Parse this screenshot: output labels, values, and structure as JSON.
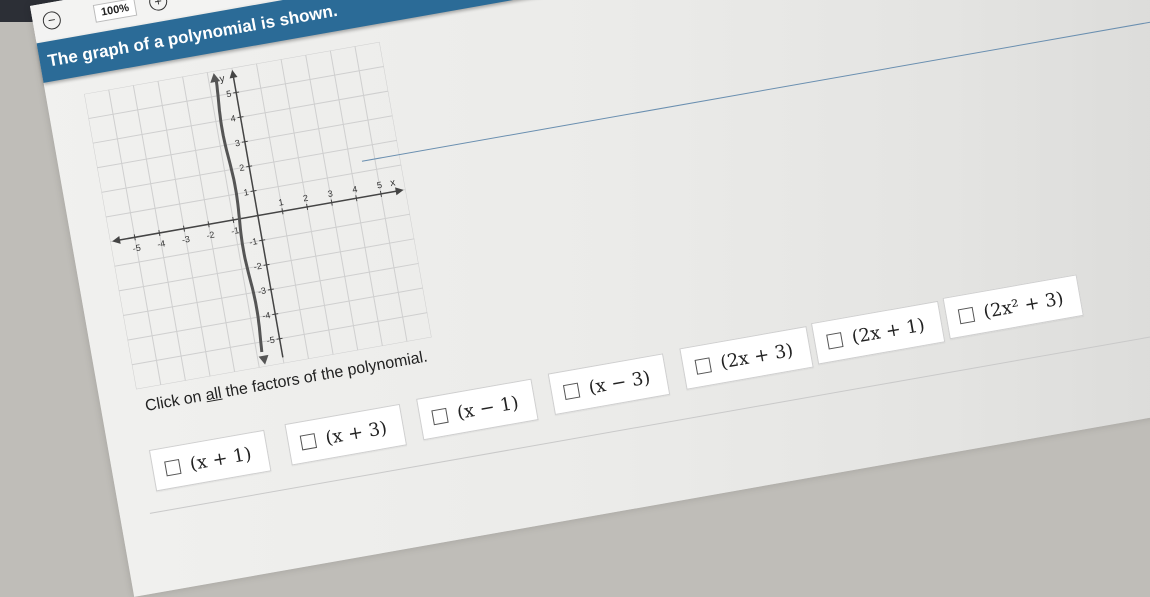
{
  "toolbar": {
    "zoom_out_icon": "minus-circle-icon",
    "zoom_in_icon": "plus-circle-icon",
    "zoom_level": "100%",
    "tools": [
      "pencil-icon",
      "eraser-icon"
    ]
  },
  "question": {
    "title": "The graph of a polynomial is shown.",
    "instruction_prefix": "Click on ",
    "instruction_emphasis": "all",
    "instruction_suffix": " the factors of the polynomial."
  },
  "graph": {
    "axis_x_label": "x",
    "axis_y_label": "y",
    "x_ticks": [
      "-5",
      "-4",
      "-3",
      "-2",
      "-1",
      "1",
      "2",
      "3",
      "4",
      "5"
    ],
    "y_ticks": [
      "5",
      "4",
      "3",
      "2",
      "1",
      "-1",
      "-2",
      "-3",
      "-4",
      "-5"
    ],
    "x_range": [
      -5,
      5
    ],
    "y_range": [
      -5,
      5
    ],
    "grid": true
  },
  "options": [
    {
      "label": "(x + 1)"
    },
    {
      "label": "(x + 3)"
    },
    {
      "label": "(x − 1)"
    },
    {
      "label": "(x − 3)"
    },
    {
      "label": "(2x + 3)"
    },
    {
      "label": "(2x + 1)"
    },
    {
      "label": "(2x² + 3)"
    }
  ],
  "colors": {
    "banner": "#2b6b97",
    "axis": "#444444",
    "curve": "#555555",
    "grid": "#cfcfcf"
  }
}
